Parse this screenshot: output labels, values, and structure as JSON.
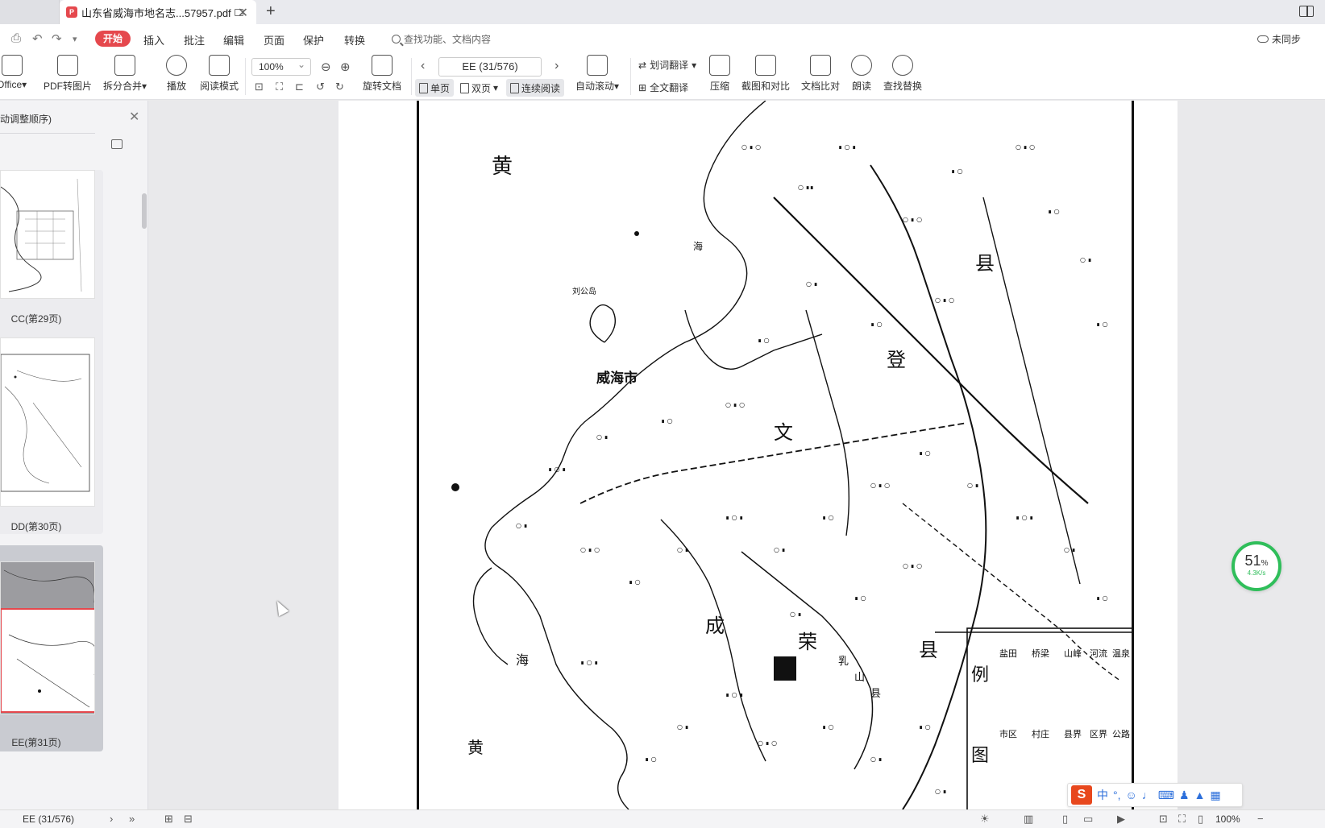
{
  "tab": {
    "title": "山东省威海市地名志...57957.pdf"
  },
  "menu": {
    "active": "开始",
    "items": [
      "插入",
      "批注",
      "编辑",
      "页面",
      "保护",
      "转换"
    ],
    "search_hint": "查找功能、文档内容",
    "sync_label": "未同步"
  },
  "toolbar": {
    "office": "Office",
    "pdf_to_image": "PDF转图片",
    "split_merge": "拆分合并",
    "play": "播放",
    "read_mode": "阅读模式",
    "zoom": "100%",
    "rotate_doc": "旋转文档",
    "page_indicator": "EE (31/576)",
    "single_page": "单页",
    "double_page": "双页",
    "continuous": "连续阅读",
    "auto_scroll": "自动滚动",
    "word_translate": "划词翻译",
    "full_translate": "全文翻译",
    "compress": "压缩",
    "screenshot_compare": "截图和对比",
    "text_compare": "文档比对",
    "read_aloud": "朗读",
    "find_replace": "查找替换"
  },
  "sidebar": {
    "title": "动调整顺序)",
    "thumbnails": [
      {
        "label": "CC(第29页)"
      },
      {
        "label": "DD(第30页)"
      },
      {
        "label": "EE(第31页)"
      }
    ]
  },
  "map": {
    "labels": {
      "sea_top": "黄",
      "sea_top2": "海",
      "sea_bottom": "黄",
      "sea_bottom2": "海",
      "weihai": "威海市",
      "county_mid": "县",
      "county_wen": "文",
      "county_deng": "登",
      "county_rong": "荣",
      "county_cheng": "成",
      "county_ru": "乳",
      "county_shan": "山",
      "county_xian": "县",
      "county_lower": "县",
      "liugong": "刘公岛",
      "legend_title": "图",
      "legend_title2": "例"
    },
    "legend": [
      "市区",
      "村庄",
      "县界",
      "区界",
      "公路",
      "盐田",
      "桥梁",
      "山峰",
      "河流",
      "温泉"
    ]
  },
  "widget": {
    "speed_percent": "51",
    "speed_unit": "%",
    "rate": "4.3K/s"
  },
  "ime": {
    "label": "中"
  },
  "status": {
    "page": "EE (31/576)",
    "zoom": "100%"
  }
}
